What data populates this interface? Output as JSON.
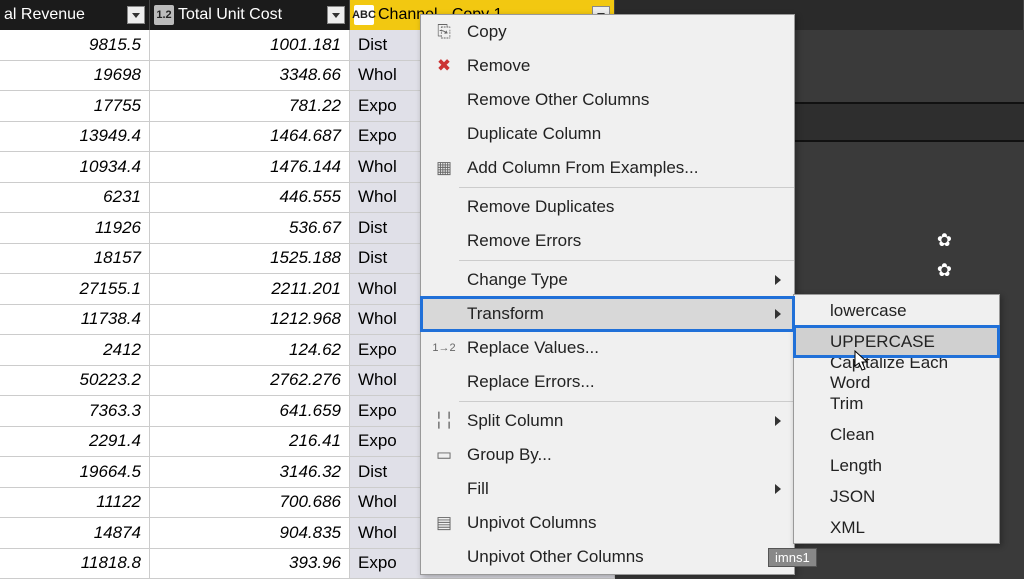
{
  "columns": {
    "revenue_label": "al Revenue",
    "cost_label": "Total Unit Cost",
    "channel_label": "Channel - Copy 1",
    "revenue_type": "1.2",
    "cost_type": "1.2",
    "channel_type": "ABC"
  },
  "rows": [
    {
      "rev": "9815.5",
      "cost": "1001.181",
      "ch": "Dist"
    },
    {
      "rev": "19698",
      "cost": "3348.66",
      "ch": "Whol"
    },
    {
      "rev": "17755",
      "cost": "781.22",
      "ch": "Expo"
    },
    {
      "rev": "13949.4",
      "cost": "1464.687",
      "ch": "Expo"
    },
    {
      "rev": "10934.4",
      "cost": "1476.144",
      "ch": "Whol"
    },
    {
      "rev": "6231",
      "cost": "446.555",
      "ch": "Whol"
    },
    {
      "rev": "11926",
      "cost": "536.67",
      "ch": "Dist"
    },
    {
      "rev": "18157",
      "cost": "1525.188",
      "ch": "Dist"
    },
    {
      "rev": "27155.1",
      "cost": "2211.201",
      "ch": "Whol"
    },
    {
      "rev": "11738.4",
      "cost": "1212.968",
      "ch": "Whol"
    },
    {
      "rev": "2412",
      "cost": "124.62",
      "ch": "Expo"
    },
    {
      "rev": "50223.2",
      "cost": "2762.276",
      "ch": "Whol"
    },
    {
      "rev": "7363.3",
      "cost": "641.659",
      "ch": "Expo"
    },
    {
      "rev": "2291.4",
      "cost": "216.41",
      "ch": "Expo"
    },
    {
      "rev": "19664.5",
      "cost": "3146.32",
      "ch": "Dist"
    },
    {
      "rev": "11122",
      "cost": "700.686",
      "ch": "Whol"
    },
    {
      "rev": "14874",
      "cost": "904.835",
      "ch": "Whol"
    },
    {
      "rev": "11818.8",
      "cost": "393.96",
      "ch": "Expo"
    }
  ],
  "menu": {
    "copy": "Copy",
    "remove": "Remove",
    "remove_other": "Remove Other Columns",
    "duplicate": "Duplicate Column",
    "add_from_examples": "Add Column From Examples...",
    "remove_dup": "Remove Duplicates",
    "remove_err": "Remove Errors",
    "change_type": "Change Type",
    "transform": "Transform",
    "replace_vals": "Replace Values...",
    "replace_err": "Replace Errors...",
    "split": "Split Column",
    "group_by": "Group By...",
    "fill": "Fill",
    "unpivot": "Unpivot Columns",
    "unpivot_other": "Unpivot Other Columns"
  },
  "submenu": {
    "lowercase": "lowercase",
    "uppercase": "UPPERCASE",
    "capitalize": "Capitalize Each Word",
    "trim": "Trim",
    "clean": "Clean",
    "length": "Length",
    "json": "JSON",
    "xml": "XML"
  },
  "badge": "imns1"
}
